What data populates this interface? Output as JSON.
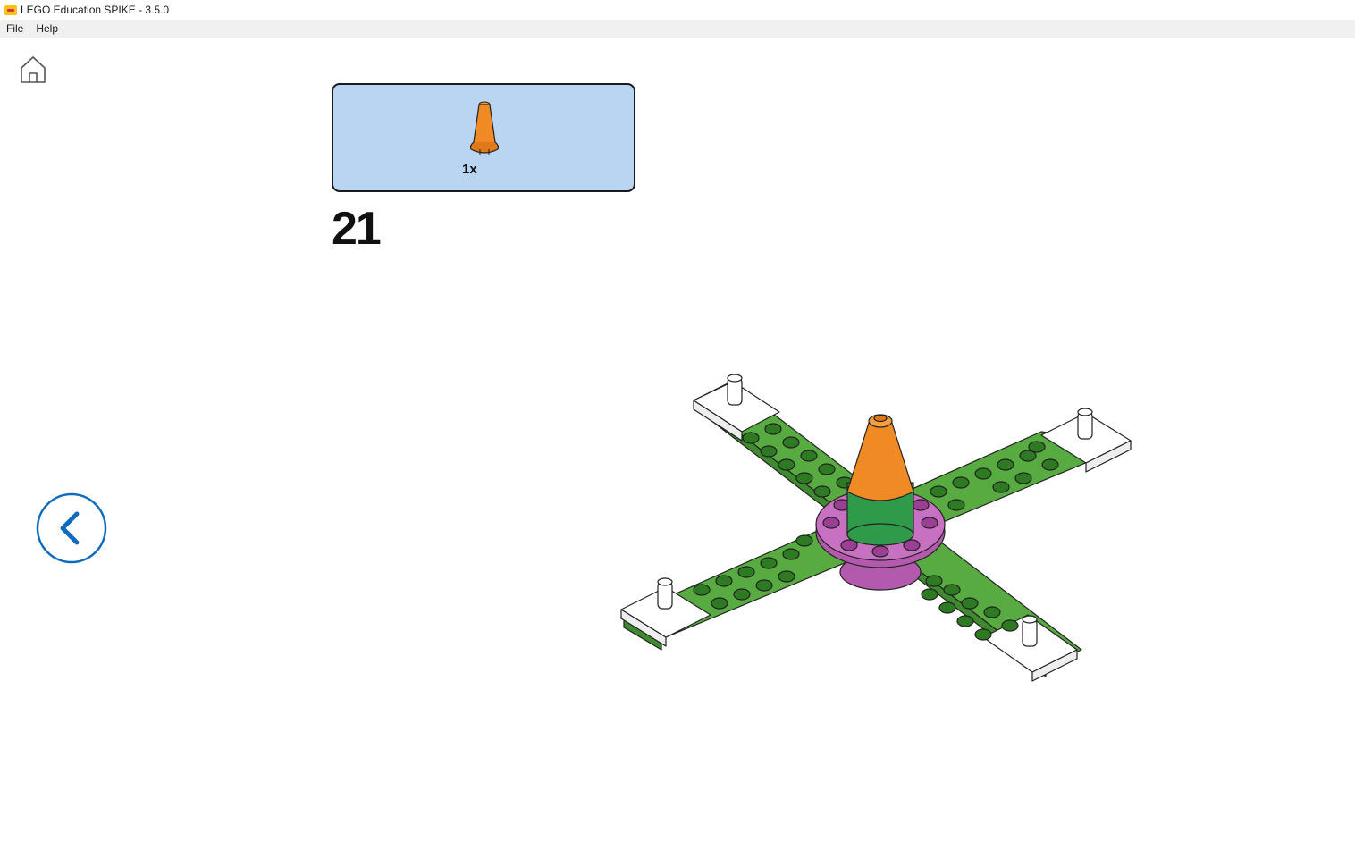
{
  "window": {
    "title": "LEGO Education SPIKE - 3.5.0"
  },
  "menu": {
    "items": [
      "File",
      "Help"
    ]
  },
  "instructions": {
    "parts_needed": [
      {
        "part": "orange-cone",
        "quantity_label": "1x"
      }
    ],
    "step_number": "21"
  },
  "icons": {
    "home": "home-icon",
    "back": "chevron-left-icon"
  },
  "colors": {
    "accent": "#0f6cbd",
    "parts_panel": "#b9d5f1",
    "brick_green": "#58ab41",
    "brick_magenta": "#c870c2",
    "cone_orange": "#f08a24"
  }
}
